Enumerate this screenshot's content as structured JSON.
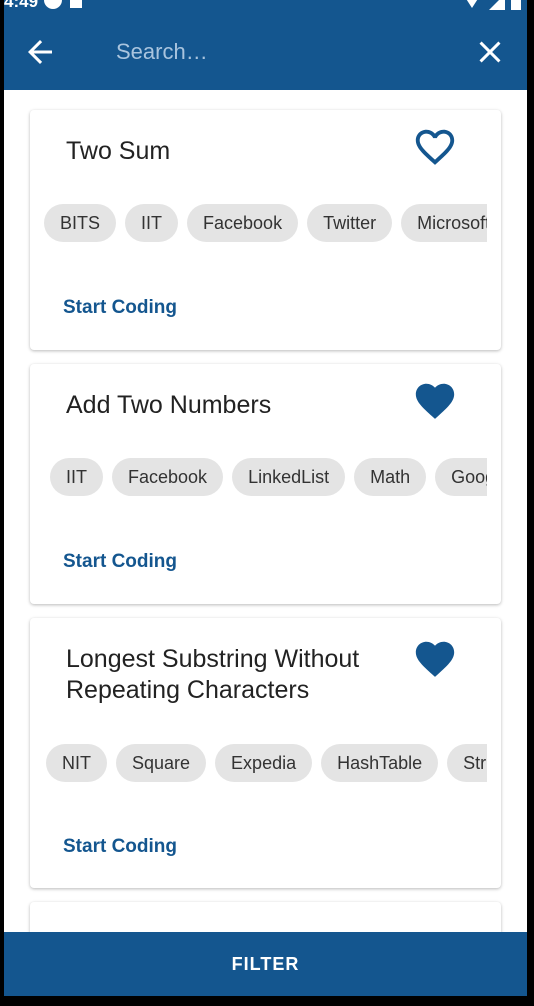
{
  "status_bar": {
    "time": "4:49"
  },
  "search": {
    "placeholder": "Search…"
  },
  "colors": {
    "primary": "#14568f",
    "chip_bg": "#e4e4e4",
    "title_text": "#222222"
  },
  "icons": {
    "back": "arrow-left-icon",
    "close": "close-icon",
    "favorite_outline": "heart-outline-icon",
    "favorite_filled": "heart-filled-icon"
  },
  "problems": [
    {
      "title": "Two Sum",
      "favorite": false,
      "tags": [
        "BITS",
        "IIT",
        "Facebook",
        "Twitter",
        "Microsoft"
      ],
      "action": "Start Coding"
    },
    {
      "title": "Add Two Numbers",
      "favorite": true,
      "tags": [
        "IIT",
        "Facebook",
        "LinkedList",
        "Math",
        "Google"
      ],
      "action": "Start Coding"
    },
    {
      "title": "Longest Substring Without Repeating Characters",
      "favorite": true,
      "tags": [
        "NIT",
        "Square",
        "Expedia",
        "HashTable",
        "String"
      ],
      "action": "Start Coding"
    }
  ],
  "footer": {
    "filter_label": "FILTER"
  }
}
